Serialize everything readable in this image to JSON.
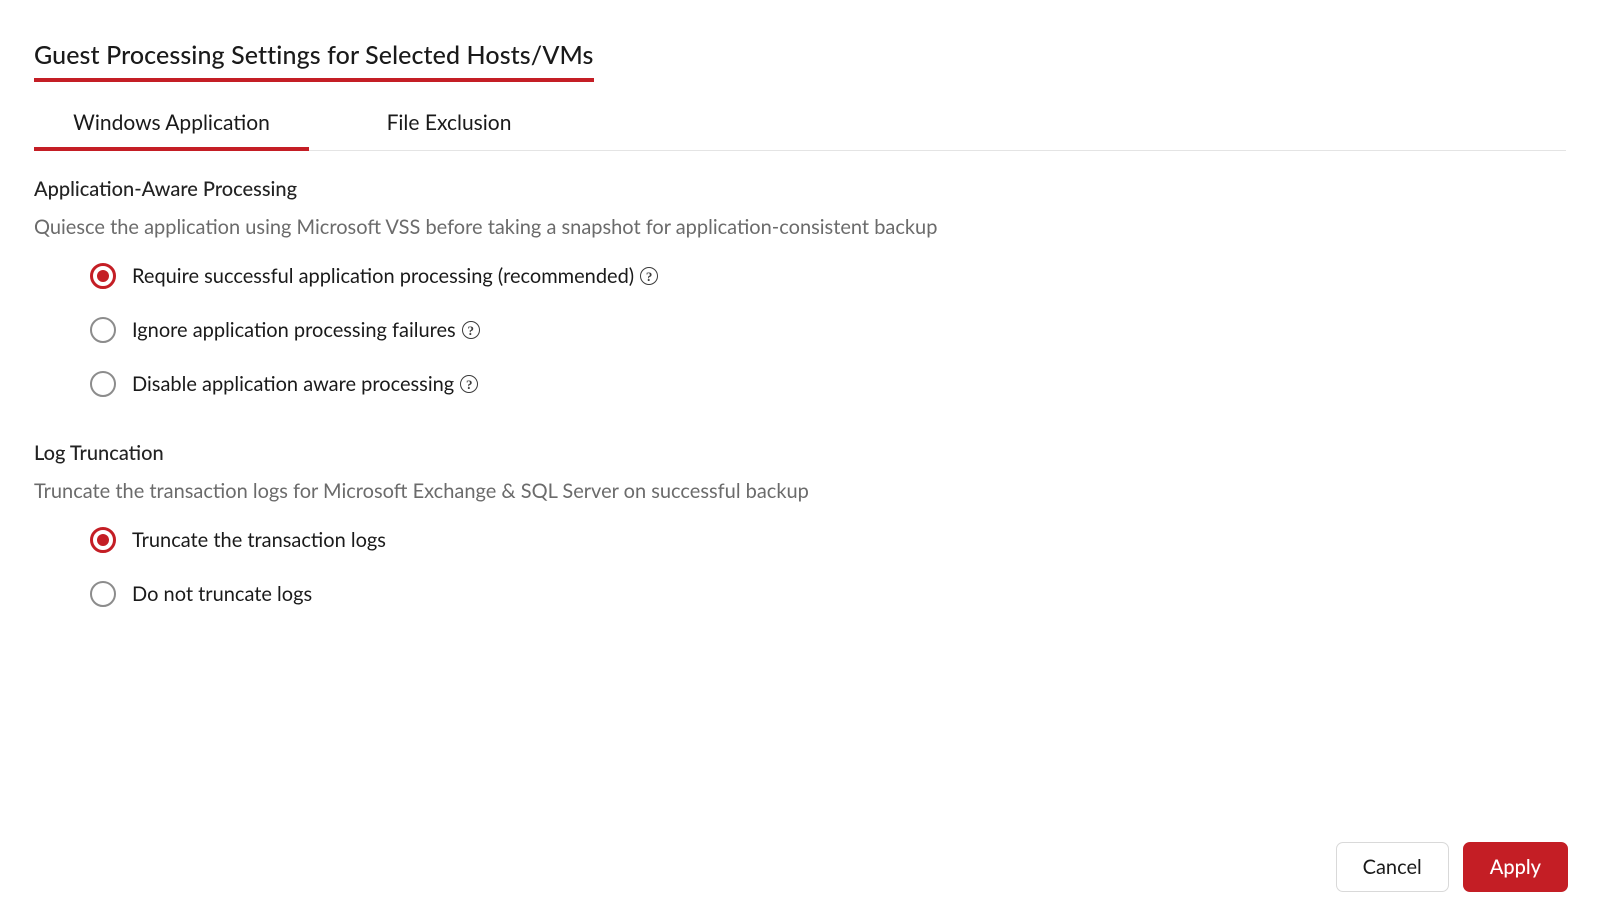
{
  "title": "Guest Processing Settings for Selected Hosts/VMs",
  "tabs": [
    {
      "label": "Windows Application",
      "active": true
    },
    {
      "label": "File Exclusion",
      "active": false
    }
  ],
  "sections": {
    "app_aware": {
      "title": "Application-Aware Processing",
      "desc": "Quiesce the application using Microsoft VSS before taking a snapshot for application-consistent backup",
      "options": [
        {
          "label": "Require successful application processing (recommended)",
          "selected": true,
          "help": true
        },
        {
          "label": "Ignore application processing failures",
          "selected": false,
          "help": true
        },
        {
          "label": "Disable application aware processing",
          "selected": false,
          "help": true
        }
      ]
    },
    "log_trunc": {
      "title": "Log Truncation",
      "desc": "Truncate the transaction logs for Microsoft Exchange & SQL Server on successful backup",
      "options": [
        {
          "label": "Truncate the transaction logs",
          "selected": true,
          "help": false
        },
        {
          "label": "Do not truncate logs",
          "selected": false,
          "help": false
        }
      ]
    }
  },
  "buttons": {
    "cancel": "Cancel",
    "apply": "Apply"
  },
  "help_glyph": "?"
}
